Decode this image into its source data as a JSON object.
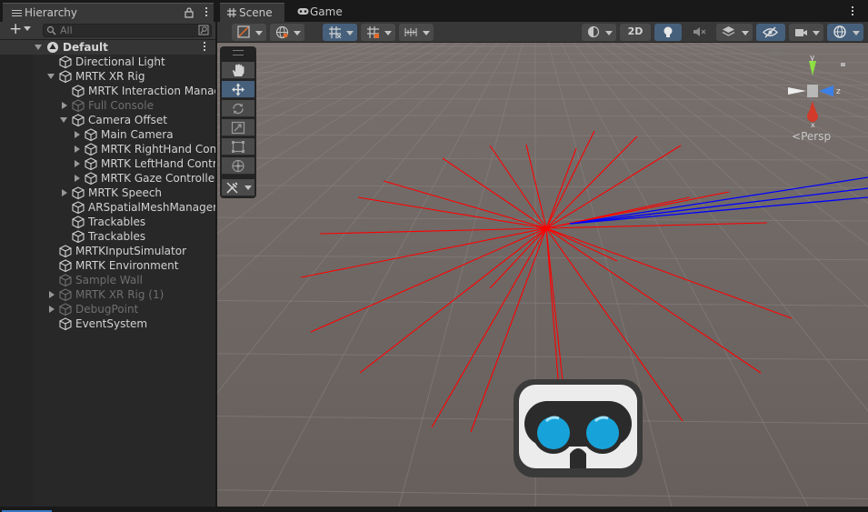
{
  "hierarchy": {
    "tab_label": "Hierarchy",
    "search_placeholder": "All",
    "items": [
      {
        "label": "Default",
        "depth": 0,
        "expander": "down",
        "icon": "unity-scene-icon",
        "style": "bold"
      },
      {
        "label": "Directional Light",
        "depth": 1,
        "expander": "none",
        "icon": "cube-icon",
        "style": "normal"
      },
      {
        "label": "MRTK XR Rig",
        "depth": 1,
        "expander": "down",
        "icon": "cube-icon",
        "style": "normal"
      },
      {
        "label": "MRTK Interaction Manag",
        "depth": 2,
        "expander": "none",
        "icon": "cube-icon",
        "style": "normal"
      },
      {
        "label": "Full Console",
        "depth": 2,
        "expander": "right",
        "icon": "cube-icon",
        "style": "dim"
      },
      {
        "label": "Camera Offset",
        "depth": 2,
        "expander": "down",
        "icon": "cube-icon",
        "style": "normal"
      },
      {
        "label": "Main Camera",
        "depth": 3,
        "expander": "right",
        "icon": "cube-icon",
        "style": "normal"
      },
      {
        "label": "MRTK RightHand Cont",
        "depth": 3,
        "expander": "right",
        "icon": "cube-icon",
        "style": "normal"
      },
      {
        "label": "MRTK LeftHand Contro",
        "depth": 3,
        "expander": "right",
        "icon": "cube-icon",
        "style": "normal"
      },
      {
        "label": "MRTK Gaze Controller",
        "depth": 3,
        "expander": "right",
        "icon": "cube-icon",
        "style": "normal"
      },
      {
        "label": "MRTK Speech",
        "depth": 2,
        "expander": "right",
        "icon": "cube-icon",
        "style": "normal"
      },
      {
        "label": "ARSpatialMeshManager",
        "depth": 2,
        "expander": "none",
        "icon": "cube-icon",
        "style": "normal"
      },
      {
        "label": "Trackables",
        "depth": 2,
        "expander": "none",
        "icon": "cube-icon",
        "style": "normal"
      },
      {
        "label": "Trackables",
        "depth": 2,
        "expander": "none",
        "icon": "cube-icon",
        "style": "normal"
      },
      {
        "label": "MRTKInputSimulator",
        "depth": 1,
        "expander": "none",
        "icon": "cube-icon",
        "style": "normal"
      },
      {
        "label": "MRTK Environment",
        "depth": 1,
        "expander": "none",
        "icon": "cube-icon",
        "style": "normal"
      },
      {
        "label": "Sample Wall",
        "depth": 1,
        "expander": "none",
        "icon": "cube-icon",
        "style": "dim"
      },
      {
        "label": "MRTK XR Rig (1)",
        "depth": 1,
        "expander": "right",
        "icon": "cube-icon",
        "style": "dim"
      },
      {
        "label": "DebugPoint",
        "depth": 1,
        "expander": "right",
        "icon": "cube-icon",
        "style": "dim"
      },
      {
        "label": "EventSystem",
        "depth": 1,
        "expander": "none",
        "icon": "cube-icon",
        "style": "normal"
      }
    ]
  },
  "scene": {
    "tabs": [
      {
        "label": "Scene",
        "icon": "grid-icon",
        "active": true
      },
      {
        "label": "Game",
        "icon": "gamepad-icon",
        "active": false
      }
    ],
    "toolbar": {
      "mode_2d_label": "2D"
    },
    "view_label": "Persp",
    "gizmo_axes": {
      "y": "y",
      "z": "z",
      "x": "x"
    }
  },
  "colors": {
    "ray_red": "#ff0000",
    "ray_blue": "#0000ff",
    "ground": "#6b6361",
    "accent_blue": "#46607c"
  }
}
